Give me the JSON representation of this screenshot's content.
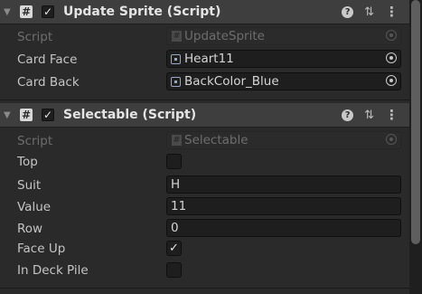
{
  "components": [
    {
      "title": "Update Sprite (Script)",
      "enabled": "✓",
      "script_label": "Script",
      "script_value": "UpdateSprite",
      "fields": [
        {
          "label": "Card Face",
          "value": "Heart11"
        },
        {
          "label": "Card Back",
          "value": "BackColor_Blue"
        }
      ]
    },
    {
      "title": "Selectable (Script)",
      "enabled": "✓",
      "script_label": "Script",
      "script_value": "Selectable",
      "fields": [
        {
          "label": "Top",
          "checked": false
        },
        {
          "label": "Suit",
          "value": "H"
        },
        {
          "label": "Value",
          "value": "11"
        },
        {
          "label": "Row",
          "value": "0"
        },
        {
          "label": "Face Up",
          "checked": true,
          "mark": "✓"
        },
        {
          "label": "In Deck Pile",
          "checked": false
        }
      ]
    }
  ],
  "icons": {
    "script": "#",
    "help": "?",
    "presets": "⇅",
    "menu": "⋮",
    "fold": "▼",
    "check": "✓"
  },
  "colors": {
    "header_bg": "#3e3e3e",
    "body_bg": "#2a2a2a",
    "field_bg": "#1e1e1e"
  }
}
